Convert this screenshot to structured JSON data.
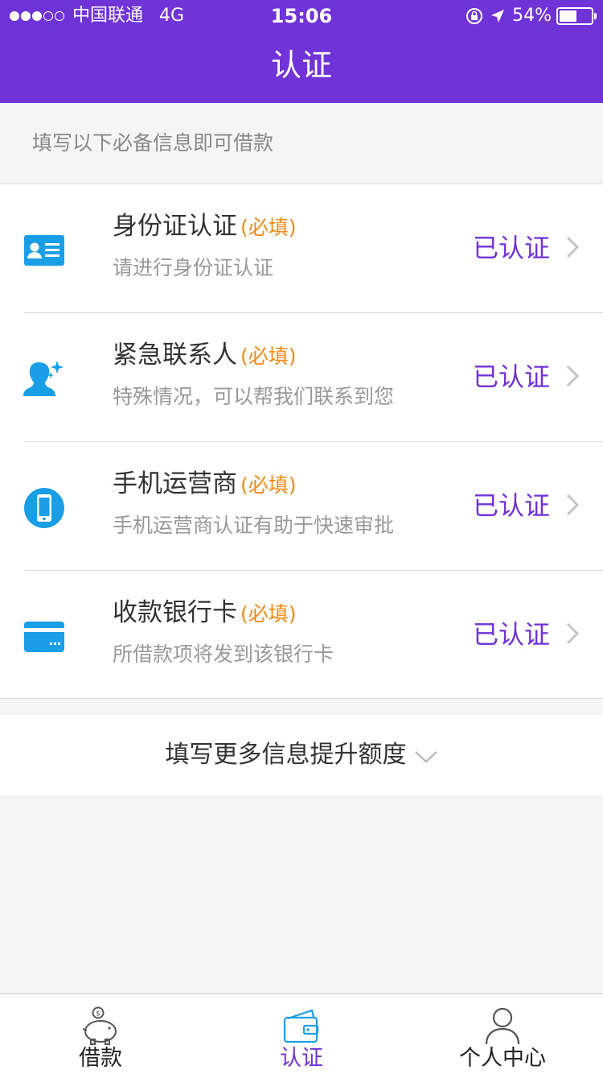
{
  "status_bar": {
    "carrier": "中国联通",
    "network": "4G",
    "time": "15:06",
    "battery": "54%",
    "battery_level": 0.54
  },
  "nav": {
    "title": "认证"
  },
  "intro": {
    "text": "填写以下必备信息即可借款"
  },
  "items": [
    {
      "title": "身份证认证",
      "required": "(必填)",
      "subtitle": "请进行身份证认证",
      "status": "已认证",
      "icon": "id-card-icon"
    },
    {
      "title": "紧急联系人",
      "required": "(必填)",
      "subtitle": "特殊情况，可以帮我们联系到您",
      "status": "已认证",
      "icon": "contact-person-icon"
    },
    {
      "title": "手机运营商",
      "required": "(必填)",
      "subtitle": "手机运营商认证有助于快速审批",
      "status": "已认证",
      "icon": "mobile-phone-icon"
    },
    {
      "title": "收款银行卡",
      "required": "(必填)",
      "subtitle": "所借款项将发到该银行卡",
      "status": "已认证",
      "icon": "bank-card-icon"
    }
  ],
  "more": {
    "label": "填写更多信息提升额度"
  },
  "tabs": [
    {
      "label": "借款",
      "icon": "piggy-bank-icon",
      "active": false
    },
    {
      "label": "认证",
      "icon": "wallet-icon",
      "active": true
    },
    {
      "label": "个人中心",
      "icon": "user-icon",
      "active": false
    }
  ],
  "colors": {
    "brand": "#7033d8",
    "required": "#ef8c18",
    "icon_blue": "#1a9fe6"
  }
}
